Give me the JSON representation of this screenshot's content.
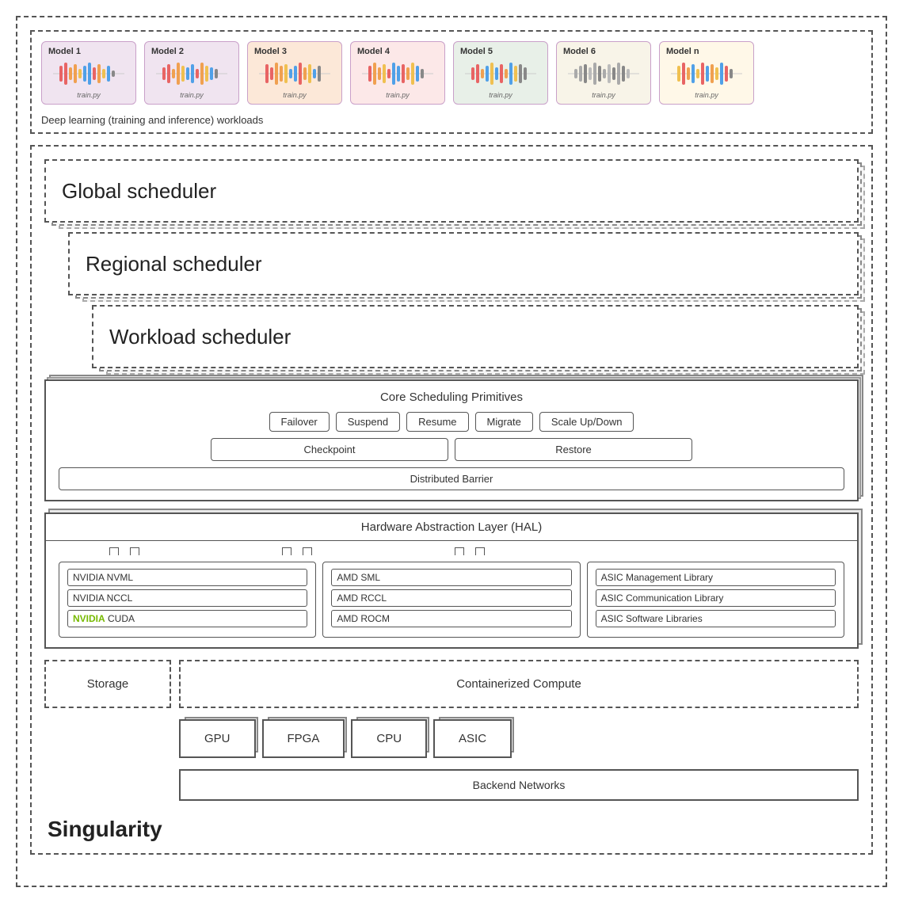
{
  "workloads": {
    "label": "Deep learning (training and inference) workloads",
    "models": [
      {
        "title": "Model 1",
        "script": "train.py",
        "color": "#e8d0e8"
      },
      {
        "title": "Model 2",
        "script": "train.py",
        "color": "#e8d0e8"
      },
      {
        "title": "Model 3",
        "script": "train.py",
        "color": "#e8d0e8"
      },
      {
        "title": "Model 4",
        "script": "train.py",
        "color": "#e8d0e8"
      },
      {
        "title": "Model 5",
        "script": "train.py",
        "color": "#e8d0e8"
      },
      {
        "title": "Model 6",
        "script": "train.py",
        "color": "#e8d0e8"
      },
      {
        "title": "Model n",
        "script": "train.py",
        "color": "#e8d0e8"
      }
    ]
  },
  "schedulers": {
    "global": "Global scheduler",
    "regional": "Regional scheduler",
    "workload": "Workload scheduler"
  },
  "core_scheduling": {
    "title": "Core Scheduling Primitives",
    "primitives": [
      "Failover",
      "Suspend",
      "Resume",
      "Migrate",
      "Scale Up/Down"
    ],
    "checkpoint": "Checkpoint",
    "restore": "Restore",
    "distributed_barrier": "Distributed Barrier"
  },
  "hal": {
    "title": "Hardware Abstraction Layer (HAL)",
    "nvidia_libs": [
      "NVIDIA NVML",
      "NVIDIA NCCL",
      "NVIDIA CUDA"
    ],
    "amd_libs": [
      "AMD SML",
      "AMD RCCL",
      "AMD ROCM"
    ],
    "asic_libs": [
      "ASIC Management Library",
      "ASIC Communication Library",
      "ASIC Software Libraries"
    ]
  },
  "storage": "Storage",
  "compute": "Containerized Compute",
  "hardware": [
    "GPU",
    "FPGA",
    "CPU",
    "ASIC"
  ],
  "backend_networks": "Backend Networks",
  "singularity": "Singularity"
}
